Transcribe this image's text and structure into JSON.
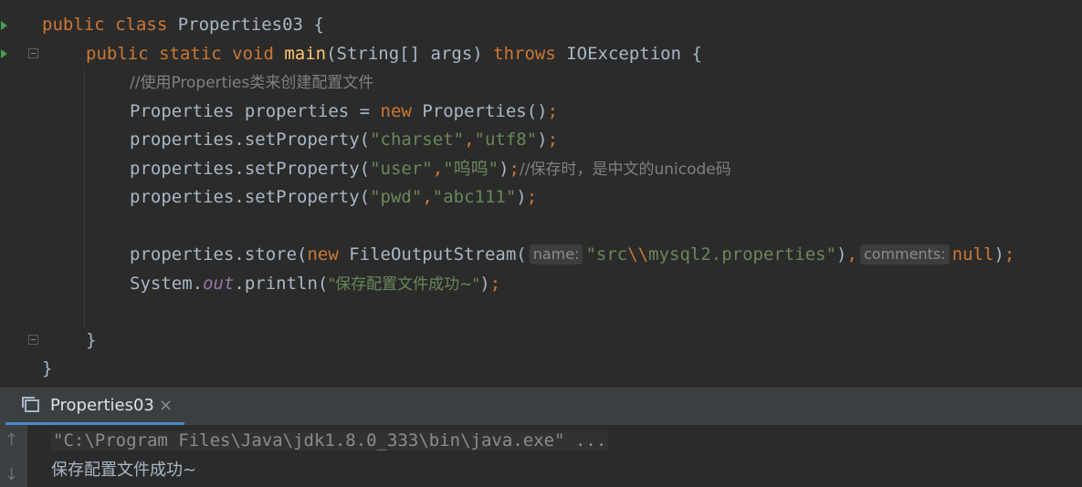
{
  "editor": {
    "class_decl": {
      "kw": "public class ",
      "name": "Properties03",
      "brace": " {"
    },
    "main_decl": {
      "kw1": "public static void ",
      "name": "main",
      "params": "(String[] args) ",
      "throws": "throws",
      "rest": " IOException {"
    },
    "comment1": "//使用Properties类来创建配置文件",
    "line_new": {
      "pre": "Properties properties = ",
      "kw": "new",
      "post": " Properties()",
      "semi": ";"
    },
    "set_charset": {
      "pre": "properties.setProperty(",
      "a": "\"charset\"",
      "comma": ",",
      "b": "\"utf8\"",
      "post": ")",
      "semi": ";"
    },
    "set_user": {
      "pre": "properties.setProperty(",
      "a": "\"user\"",
      "comma": ",",
      "b": "\"呜呜\"",
      "post": ")",
      "semi": ";",
      "comment": "//保存时，是中文的unicode码"
    },
    "set_pwd": {
      "pre": "properties.setProperty(",
      "a": "\"pwd\"",
      "comma": ",",
      "b": "\"abc111\"",
      "post": ")",
      "semi": ";"
    },
    "store": {
      "pre": "properties.store(",
      "kw": "new",
      "cls": " FileOutputStream(",
      "hint_name": "name:",
      "str_a": "\"src",
      "esc": "\\\\",
      "str_b": "mysql2.properties\"",
      "mid": ")",
      "comma": ",",
      "hint_comments": "comments:",
      "null_kw": "null",
      "close": ")",
      "semi": ";"
    },
    "println": {
      "pre": "System.",
      "field": "out",
      "mid": ".println(",
      "str": "\"保存配置文件成功~\"",
      "post": ")",
      "semi": ";"
    },
    "close_method": "}",
    "close_class": "}"
  },
  "run_panel": {
    "tab_label": "Properties03",
    "tab_close": "×",
    "up_arrow": "↑",
    "down_arrow": "↓",
    "command": "\"C:\\Program Files\\Java\\jdk1.8.0_333\\bin\\java.exe\" ...",
    "output": "保存配置文件成功~"
  },
  "colors": {
    "background": "#2b2b2b",
    "keyword": "#cc7832",
    "string": "#6a8759",
    "method": "#ffc66d",
    "comment": "#808080",
    "text": "#a9b7c6",
    "static_field": "#9876aa",
    "run_icon": "#499c54",
    "tab_underline": "#4a88c7"
  }
}
